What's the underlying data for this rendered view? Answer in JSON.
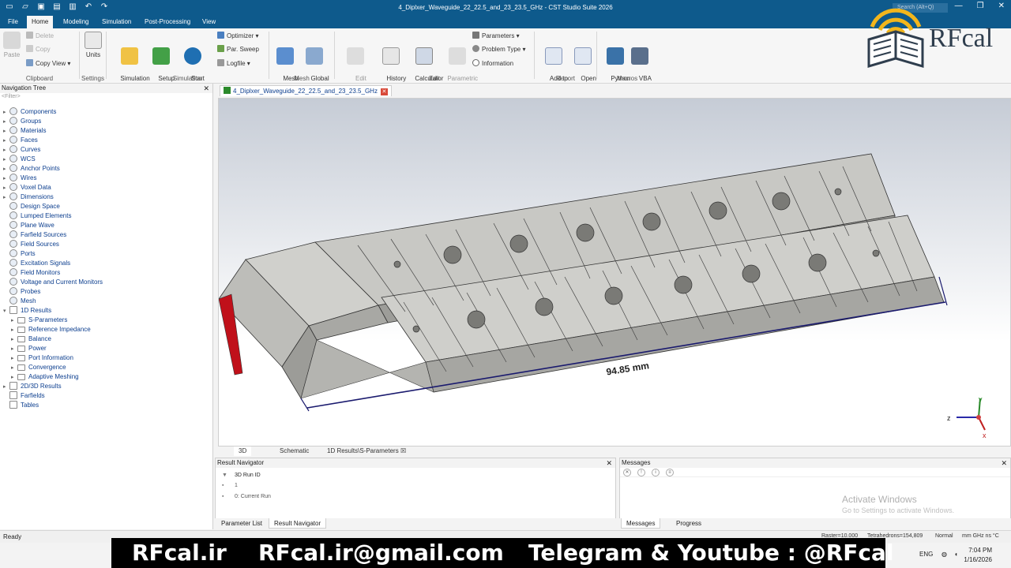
{
  "titlebar": {
    "title": "4_Diplxer_Waveguide_22_22.5_and_23_23.5_GHz - CST Studio Suite 2026",
    "search_placeholder": "Search (Alt+Q)"
  },
  "menu": {
    "tabs": [
      "File",
      "Home",
      "Modeling",
      "Simulation",
      "Post-Processing",
      "View"
    ],
    "active": "Home"
  },
  "ribbon": {
    "clipboard": {
      "paste": "Paste",
      "delete": "Delete",
      "copy": "Copy",
      "copy_view": "Copy View",
      "label": "Clipboard"
    },
    "settings": {
      "units": "Units",
      "label": "Settings"
    },
    "simulation": {
      "sim_project": "Simulation\nProject",
      "setup_solver": "Setup\nSolver",
      "start_sim": "Start\nSimulation",
      "optimizer": "Optimizer",
      "par_sweep": "Par. Sweep",
      "logfile": "Logfile",
      "label": "Simulation"
    },
    "mesh": {
      "mesh_view": "Mesh\nView",
      "global_props": "Global\nProperties",
      "label": "Mesh"
    },
    "edit": {
      "edit_props": "Edit\nProperties",
      "history_list": "History\nList",
      "calculator": "Calculator",
      "param_update": "Parametric\nUpdate",
      "parameters": "Parameters",
      "problem_type": "Problem Type",
      "information": "Information",
      "label": "Edit"
    },
    "report": {
      "add_report": "Add to\nReport",
      "open_report": "Open\nReport",
      "label": "Report"
    },
    "macros": {
      "python": "Python",
      "vba": "VBA\nMacros",
      "label": "Macros"
    }
  },
  "navtree": {
    "title": "Navigation Tree",
    "filter": "<Filter>",
    "items": [
      {
        "label": "Components",
        "type": "sphere",
        "depth": 0,
        "exp": "▸"
      },
      {
        "label": "Groups",
        "type": "sphere",
        "depth": 0,
        "exp": "▸"
      },
      {
        "label": "Materials",
        "type": "sphere",
        "depth": 0,
        "exp": "▸"
      },
      {
        "label": "Faces",
        "type": "sphere",
        "depth": 0,
        "exp": "▸"
      },
      {
        "label": "Curves",
        "type": "sphere",
        "depth": 0,
        "exp": "▸"
      },
      {
        "label": "WCS",
        "type": "sphere",
        "depth": 0,
        "exp": "▸"
      },
      {
        "label": "Anchor Points",
        "type": "sphere",
        "depth": 0,
        "exp": "▸"
      },
      {
        "label": "Wires",
        "type": "sphere",
        "depth": 0,
        "exp": "▸"
      },
      {
        "label": "Voxel Data",
        "type": "sphere",
        "depth": 0,
        "exp": "▸"
      },
      {
        "label": "Dimensions",
        "type": "sphere",
        "depth": 0,
        "exp": "▸"
      },
      {
        "label": "Design Space",
        "type": "sphere",
        "depth": 0,
        "exp": ""
      },
      {
        "label": "Lumped Elements",
        "type": "sphere",
        "depth": 0,
        "exp": ""
      },
      {
        "label": "Plane Wave",
        "type": "sphere",
        "depth": 0,
        "exp": ""
      },
      {
        "label": "Farfield Sources",
        "type": "sphere",
        "depth": 0,
        "exp": ""
      },
      {
        "label": "Field Sources",
        "type": "sphere",
        "depth": 0,
        "exp": ""
      },
      {
        "label": "Ports",
        "type": "sphere",
        "depth": 0,
        "exp": ""
      },
      {
        "label": "Excitation Signals",
        "type": "sphere",
        "depth": 0,
        "exp": ""
      },
      {
        "label": "Field Monitors",
        "type": "sphere",
        "depth": 0,
        "exp": ""
      },
      {
        "label": "Voltage and Current Monitors",
        "type": "sphere",
        "depth": 0,
        "exp": ""
      },
      {
        "label": "Probes",
        "type": "sphere",
        "depth": 0,
        "exp": ""
      },
      {
        "label": "Mesh",
        "type": "sphere",
        "depth": 0,
        "exp": ""
      },
      {
        "label": "1D Results",
        "type": "sq",
        "depth": 0,
        "exp": "▾"
      },
      {
        "label": "S-Parameters",
        "type": "folder",
        "depth": 1,
        "exp": "▸"
      },
      {
        "label": "Reference Impedance",
        "type": "folder",
        "depth": 1,
        "exp": "▸"
      },
      {
        "label": "Balance",
        "type": "folder",
        "depth": 1,
        "exp": "▸"
      },
      {
        "label": "Power",
        "type": "folder",
        "depth": 1,
        "exp": "▸"
      },
      {
        "label": "Port Information",
        "type": "folder",
        "depth": 1,
        "exp": "▸"
      },
      {
        "label": "Convergence",
        "type": "folder",
        "depth": 1,
        "exp": "▸"
      },
      {
        "label": "Adaptive Meshing",
        "type": "folder",
        "depth": 1,
        "exp": "▸"
      },
      {
        "label": "2D/3D Results",
        "type": "sq",
        "depth": 0,
        "exp": "▸"
      },
      {
        "label": "Farfields",
        "type": "sq",
        "depth": 0,
        "exp": ""
      },
      {
        "label": "Tables",
        "type": "sq",
        "depth": 0,
        "exp": ""
      }
    ]
  },
  "document": {
    "tab": "4_Diplxer_Waveguide_22_22.5_and_23_23.5_GHz"
  },
  "viewport": {
    "dimension": "94.85 mm",
    "axis_x": "x",
    "axis_y": "y",
    "axis_z": "z"
  },
  "viewtabs": [
    "3D",
    "Schematic",
    "1D Results\\S-Parameters"
  ],
  "result_navigator": {
    "title": "Result Navigator",
    "header": "3D Run ID",
    "rows": [
      "1",
      "0: Current Run"
    ],
    "tabs": [
      "Parameter List",
      "Result Navigator"
    ]
  },
  "messages": {
    "title": "Messages",
    "tabs": [
      "Messages",
      "Progress"
    ],
    "activate": "Activate Windows",
    "activate_sub": "Go to Settings to activate Windows."
  },
  "status": {
    "ready": "Ready",
    "raster": "Raster=10.000",
    "tetra": "Tetrahedrons=154,809",
    "mode": "Normal",
    "units": "mm  GHz  ns  °C"
  },
  "taskbar": {
    "lang": "ENG",
    "time": "7:04 PM",
    "date": "1/16/2026"
  },
  "banner": {
    "site": "RFcal.ir",
    "email": "RFcal.ir@gmail.com",
    "social": "Telegram & Youtube : @RFcal"
  },
  "logo": {
    "text": "RFcal"
  },
  "colors": {
    "titlebar": "#0e5a8c",
    "port": "#c0101a",
    "model": "#c4c4c0",
    "dimension_line": "#1a1a6e"
  }
}
